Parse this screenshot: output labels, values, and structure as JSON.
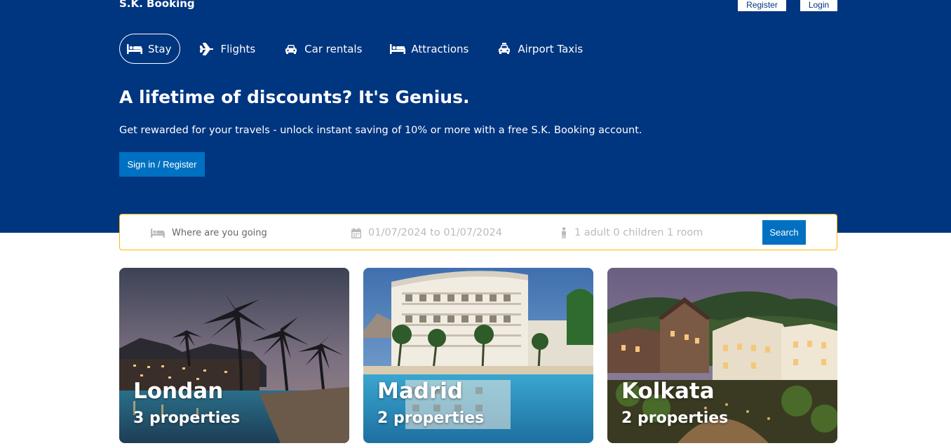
{
  "header": {
    "logo": "S.K. Booking",
    "register_label": "Register",
    "login_label": "Login"
  },
  "nav": {
    "items": [
      {
        "label": "Stay",
        "icon": "bed-icon"
      },
      {
        "label": "Flights",
        "icon": "plane-icon"
      },
      {
        "label": "Car rentals",
        "icon": "car-icon"
      },
      {
        "label": "Attractions",
        "icon": "bed-icon"
      },
      {
        "label": "Airport Taxis",
        "icon": "taxi-icon"
      }
    ]
  },
  "hero": {
    "title": "A lifetime of discounts? It's Genius.",
    "subtitle": "Get rewarded for your travels - unlock instant saving of 10% or more with a free S.K. Booking account.",
    "signin_label": "Sign in / Register"
  },
  "search": {
    "destination_placeholder": "Where are you going",
    "dates": "01/07/2024 to 01/07/2024",
    "guests": "1 adult 0 children 1 room",
    "button_label": "Search"
  },
  "cards": [
    {
      "city": "Londan",
      "properties": "3 properties"
    },
    {
      "city": "Madrid",
      "properties": "2 properties"
    },
    {
      "city": "Kolkata",
      "properties": "2 properties"
    }
  ],
  "colors": {
    "brand": "#003580",
    "accent": "#0071c2",
    "search_border": "#febb02"
  }
}
